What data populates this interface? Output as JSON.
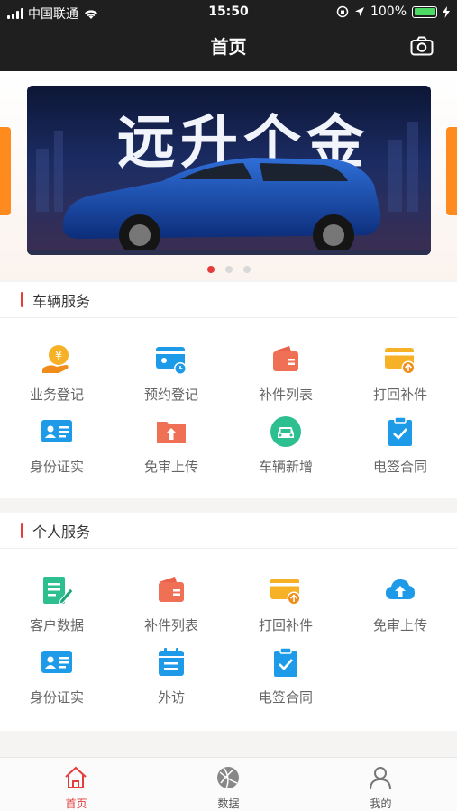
{
  "status": {
    "carrier": "中国联通",
    "time": "15:50",
    "battery": "100%"
  },
  "nav": {
    "title": "首页"
  },
  "banner": {
    "headline": "远升个金",
    "page_count": 3,
    "active_page": 1
  },
  "sections": [
    {
      "title": "车辆服务",
      "items": [
        {
          "label": "业务登记",
          "icon": "money-bag-icon"
        },
        {
          "label": "预约登记",
          "icon": "card-clock-icon"
        },
        {
          "label": "补件列表",
          "icon": "wallet-icon"
        },
        {
          "label": "打回补件",
          "icon": "card-return-icon"
        },
        {
          "label": "身份证实",
          "icon": "id-card-icon"
        },
        {
          "label": "免审上传",
          "icon": "folder-upload-icon"
        },
        {
          "label": "车辆新增",
          "icon": "car-icon"
        },
        {
          "label": "电签合同",
          "icon": "clipboard-check-icon"
        }
      ]
    },
    {
      "title": "个人服务",
      "items": [
        {
          "label": "客户数据",
          "icon": "edit-doc-icon"
        },
        {
          "label": "补件列表",
          "icon": "wallet-icon"
        },
        {
          "label": "打回补件",
          "icon": "card-return-icon"
        },
        {
          "label": "免审上传",
          "icon": "cloud-upload-icon"
        },
        {
          "label": "身份证实",
          "icon": "id-card-icon"
        },
        {
          "label": "外访",
          "icon": "calendar-list-icon"
        },
        {
          "label": "电签合同",
          "icon": "clipboard-check-icon"
        }
      ]
    }
  ],
  "tabbar": [
    {
      "label": "首页",
      "icon": "home-icon",
      "active": true
    },
    {
      "label": "数据",
      "icon": "globe-icon",
      "active": false
    },
    {
      "label": "我的",
      "icon": "user-icon",
      "active": false
    }
  ],
  "colors": {
    "accent": "#e53c3c",
    "orange": "#ff8a1e",
    "blue": "#1e9be8",
    "green": "#2dbf8f"
  }
}
